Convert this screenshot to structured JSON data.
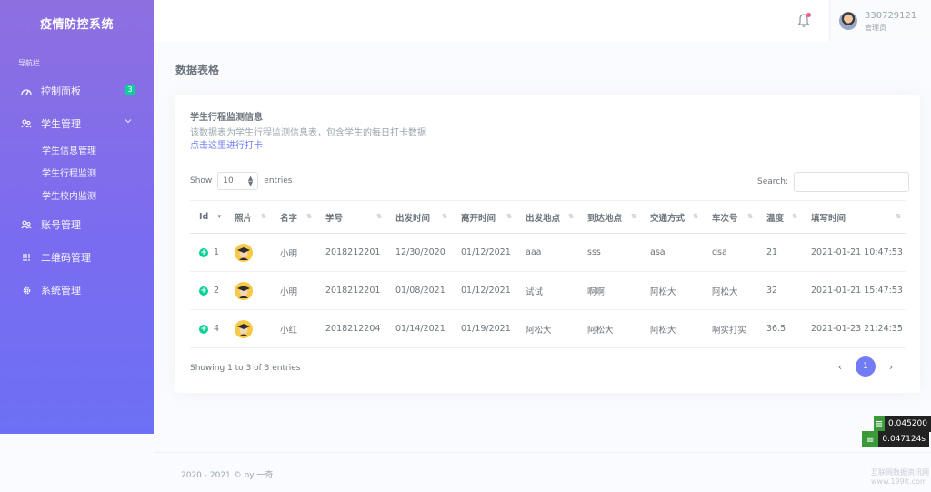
{
  "sidebar": {
    "brand": "疫情防控系统",
    "nav_title": "导航栏",
    "items": [
      {
        "label": "控制面板",
        "badge": "3"
      },
      {
        "label": "学生管理"
      },
      {
        "label": "账号管理"
      },
      {
        "label": "二维码管理"
      },
      {
        "label": "系统管理"
      }
    ],
    "subitems": [
      "学生信息管理",
      "学生行程监测",
      "学生校内监测"
    ]
  },
  "topbar": {
    "username": "330729121",
    "role": "管理员"
  },
  "page": {
    "title": "数据表格"
  },
  "card": {
    "title": "学生行程监测信息",
    "description": "该数据表为学生行程监测信息表，包含学生的每日打卡数据",
    "link": "点击这里进行打卡",
    "show_label": "Show",
    "length_value": "10",
    "entries_label": "entries",
    "search_label": "Search:",
    "info": "Showing 1 to 3 of 3 entries",
    "current_page": "1",
    "prev": "‹",
    "next": "›"
  },
  "table": {
    "headers": [
      "Id",
      "照片",
      "名字",
      "学号",
      "出发时间",
      "离开时间",
      "出发地点",
      "到达地点",
      "交通方式",
      "车次号",
      "温度",
      "填写时间"
    ],
    "rows": [
      [
        "1",
        "",
        "小明",
        "2018212201",
        "12/30/2020",
        "01/12/2021",
        "aaa",
        "sss",
        "asa",
        "dsa",
        "21",
        "2021-01-21 10:47:53"
      ],
      [
        "2",
        "",
        "小明",
        "2018212201",
        "01/08/2021",
        "01/12/2021",
        "试试",
        "啊啊",
        "阿松大",
        "阿松大",
        "32",
        "2021-01-21 15:47:53"
      ],
      [
        "4",
        "",
        "小红",
        "2018212204",
        "01/14/2021",
        "01/19/2021",
        "阿松大",
        "阿松大",
        "阿松大",
        "啊实打实",
        "36.5",
        "2021-01-23 21:24:35"
      ]
    ]
  },
  "footer": {
    "text": "2020 - 2021 © by 一奇"
  },
  "widgets": {
    "speed1": "0.045200",
    "speed2": "0.047124s"
  },
  "watermark": {
    "line1": "互联网数据资讯网",
    "line2": "www.199it.com"
  },
  "colors": {
    "primary": "#727cf5",
    "success": "#0acf97",
    "sidebar_top": "#8e6fe0",
    "sidebar_bottom": "#6d70f5"
  }
}
